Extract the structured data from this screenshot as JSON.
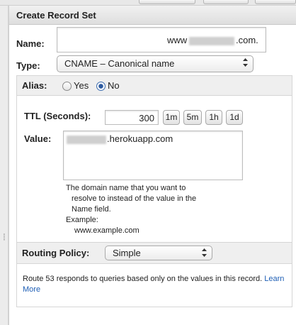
{
  "panel": {
    "title": "Create Record Set"
  },
  "name_field": {
    "label": "Name:",
    "prefix": "www",
    "suffix": ".com."
  },
  "type_field": {
    "label": "Type:",
    "selected": "CNAME – Canonical name"
  },
  "alias": {
    "label": "Alias:",
    "yes_label": "Yes",
    "no_label": "No",
    "selected": "No"
  },
  "ttl": {
    "label": "TTL (Seconds):",
    "value": "300",
    "presets": [
      "1m",
      "5m",
      "1h",
      "1d"
    ]
  },
  "value_field": {
    "label": "Value:",
    "suffix": ".herokuapp.com",
    "help_lines": [
      "The domain name that you want to",
      "resolve to instead of the value in the",
      "Name field.",
      "Example:",
      "www.example.com"
    ]
  },
  "routing": {
    "label": "Routing Policy:",
    "selected": "Simple",
    "help_text": "Route 53 responds to queries based only on the values in this record.",
    "learn_more": "Learn More"
  },
  "colors": {
    "link": "#1f5fb5",
    "radio_selected": "#2c5aa0",
    "header_bg": "#e4e4e4"
  }
}
